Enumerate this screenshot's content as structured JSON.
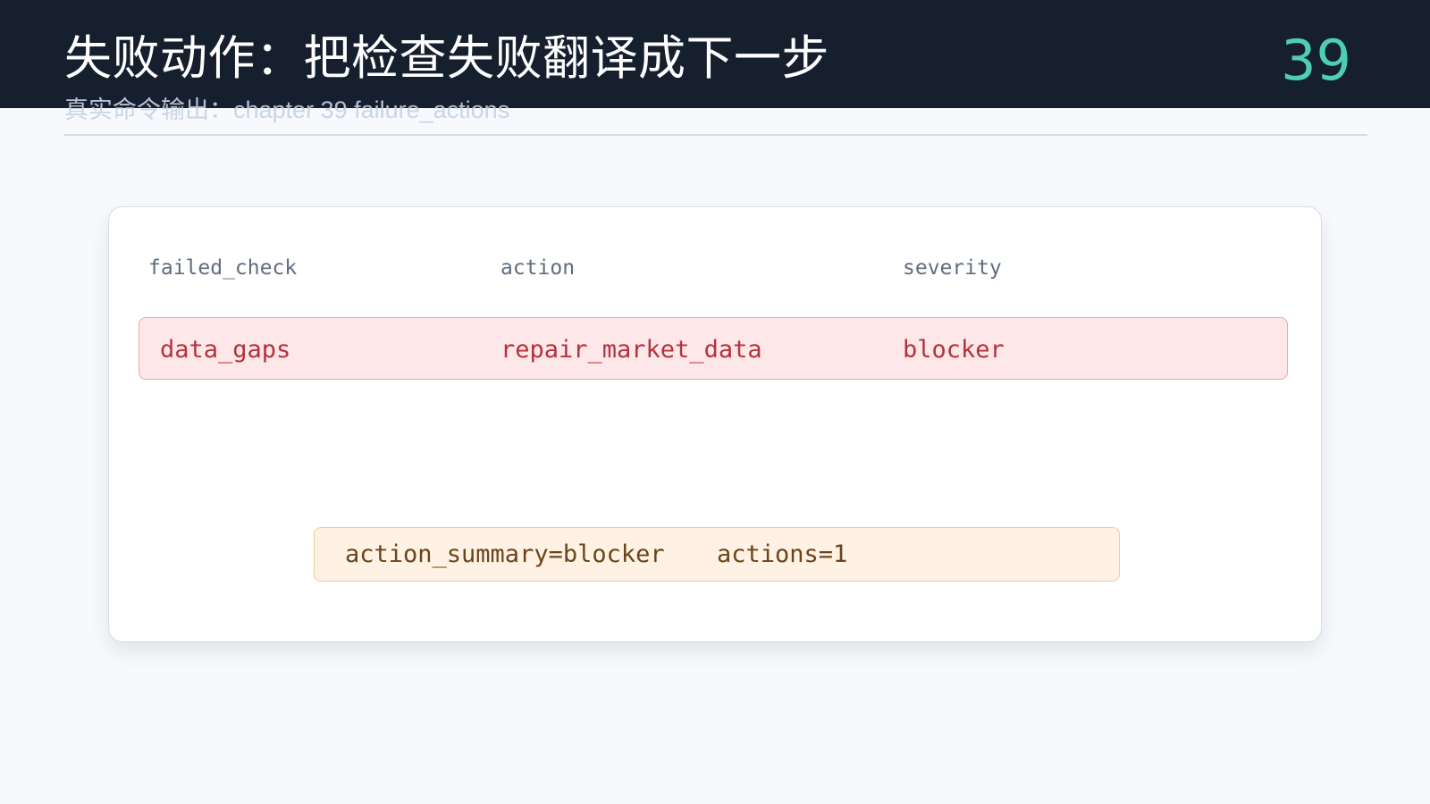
{
  "slide": {
    "title": "失败动作：把检查失败翻译成下一步",
    "subtitle": "真实命令输出：chapter 39 failure_actions",
    "page_number": "39"
  },
  "table": {
    "headers": [
      "failed_check",
      "action",
      "severity"
    ],
    "rows": [
      [
        "data_gaps",
        "repair_market_data",
        "blocker"
      ]
    ]
  },
  "summary": {
    "action_summary": "action_summary=blocker",
    "actions": "actions=1"
  },
  "colors": {
    "header_background": "#151f2e",
    "page_number": "#4ecdb7",
    "blocker_row_background": "#fde7e9",
    "blocker_text": "#b4323b",
    "summary_background": "#fff1e3",
    "summary_text": "#6a4519"
  }
}
